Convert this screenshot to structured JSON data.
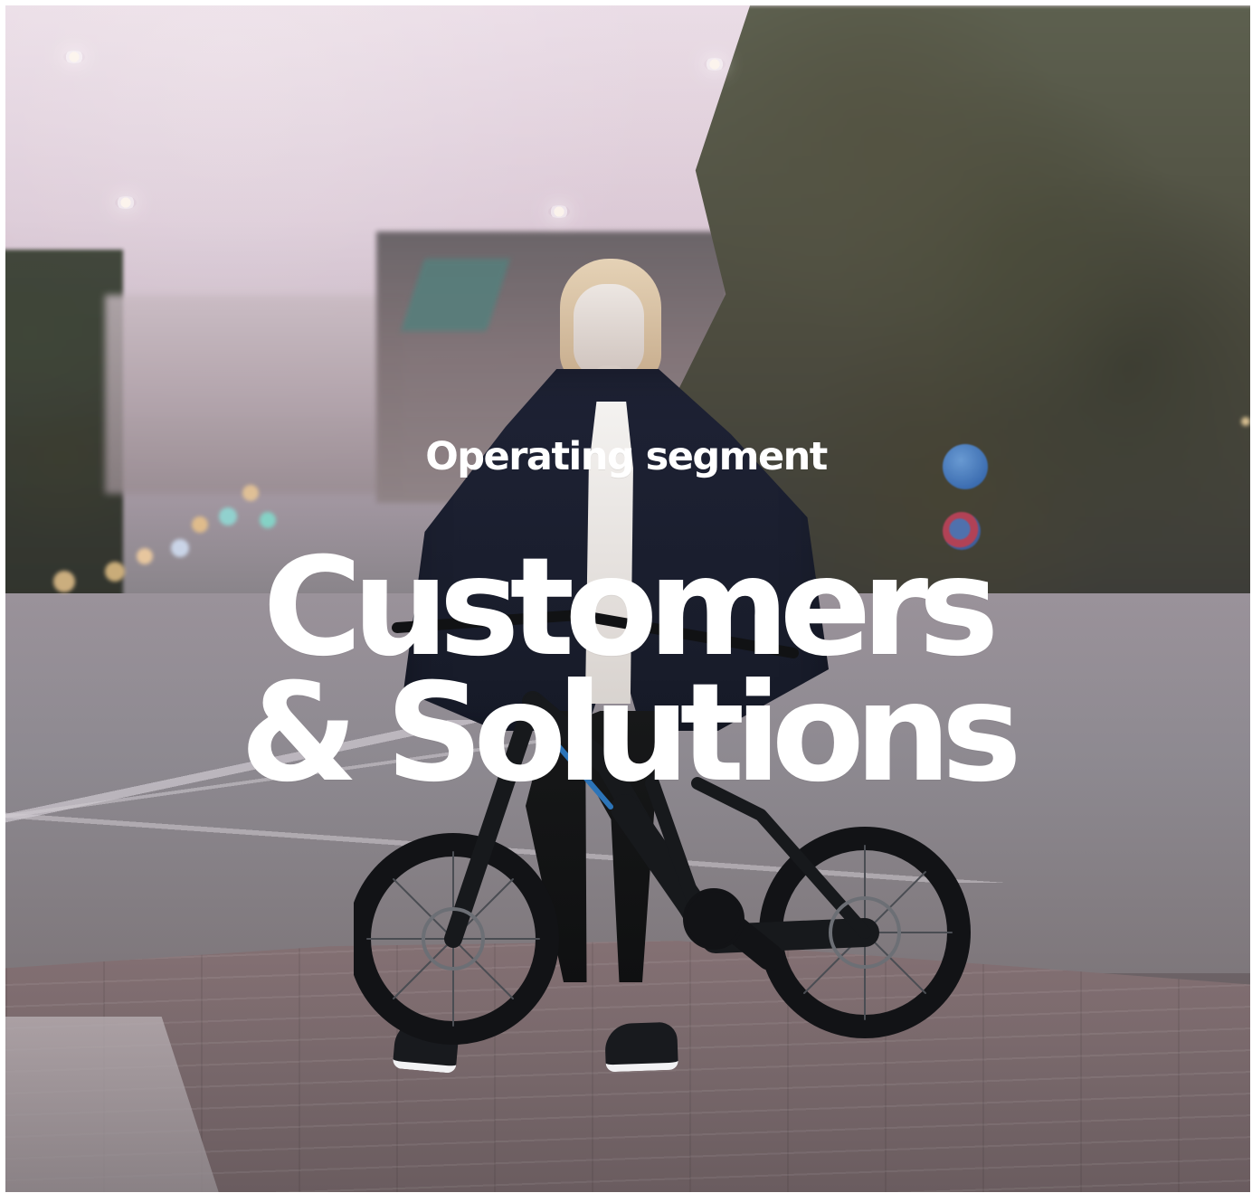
{
  "hero": {
    "eyebrow": "Operating segment",
    "headline_line_1": "Customers",
    "headline_line_2": "& Solutions"
  },
  "visual": {
    "background_scene": "woman-with-e-bike-street",
    "accent_text_color": "#FFFFFF"
  }
}
